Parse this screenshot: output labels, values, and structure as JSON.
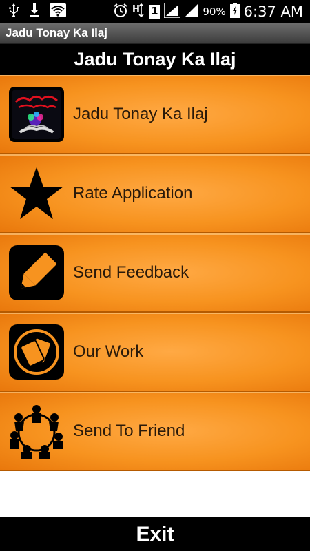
{
  "status_bar": {
    "battery_percent": "90%",
    "time": "6:37 AM",
    "sim_number": "1",
    "icons": [
      "usb-icon",
      "download-icon",
      "wifi-icon",
      "alarm-icon",
      "network-h-icon",
      "signal-icon",
      "battery-icon"
    ]
  },
  "title_bar": {
    "title": "Jadu Tonay Ka Ilaj"
  },
  "header": {
    "title": "Jadu Tonay Ka Ilaj"
  },
  "menu": {
    "items": [
      {
        "label": "Jadu Tonay Ka Ilaj",
        "icon": "app-logo-icon"
      },
      {
        "label": "Rate Application",
        "icon": "star-icon"
      },
      {
        "label": "Send Feedback",
        "icon": "pencil-icon"
      },
      {
        "label": "Our Work",
        "icon": "cards-icon"
      },
      {
        "label": "Send To Friend",
        "icon": "people-circle-icon"
      }
    ]
  },
  "exit": {
    "label": "Exit"
  },
  "colors": {
    "item_orange": "#f7931f",
    "item_border": "#b55a00",
    "bars": "#000000"
  }
}
